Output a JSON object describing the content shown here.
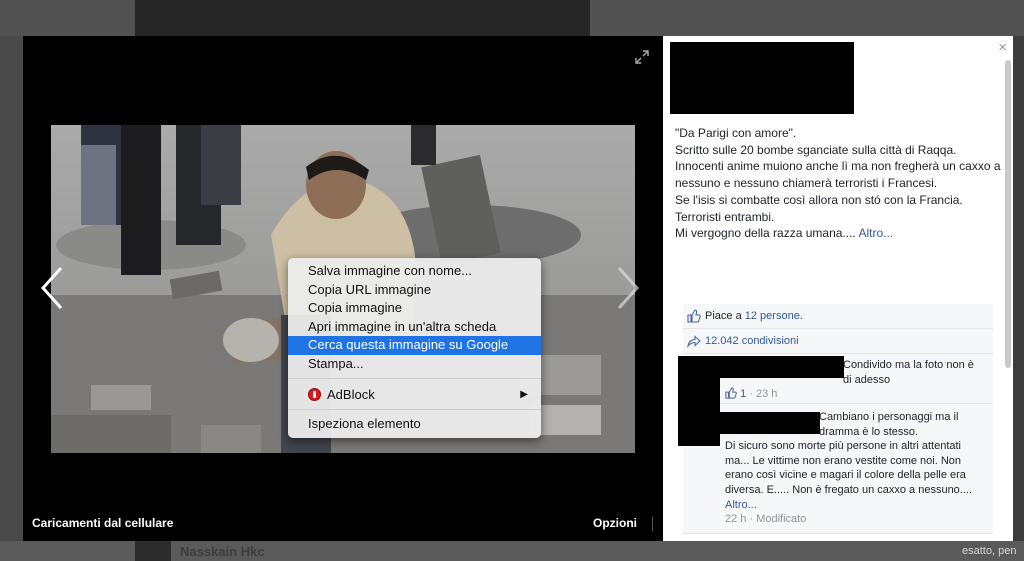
{
  "viewer": {
    "caption": "Caricamenti dal cellulare",
    "options_label": "Opzioni"
  },
  "context_menu": {
    "items": [
      "Salva immagine con nome...",
      "Copia URL immagine",
      "Copia immagine",
      "Apri immagine in un'altra scheda",
      "Cerca questa immagine su Google",
      "Stampa..."
    ],
    "highlighted_index": 4,
    "extension": "AdBlock",
    "inspect": "Ispeziona elemento"
  },
  "post": {
    "lines": [
      "\"Da Parigi con amore\".",
      "Scritto sulle 20 bombe sganciate sulla città di Raqqa.",
      "Innocenti anime muiono anche lì ma non fregherà un caxxo a nessuno e nessuno chiamerà terroristi i Francesi.",
      "Se l'isis si combatte così allora non stó con la Francia.",
      "Terroristi entrambi.",
      "Mi vergogno della razza umana...."
    ],
    "more_link": "Altro..."
  },
  "ufi": {
    "likes_prefix": "Piace a",
    "likes_link": "12 persone",
    "likes_suffix": ".",
    "shares": "12.042 condivisioni"
  },
  "comments": [
    {
      "text": "Condivido ma la foto non è di adesso",
      "likes": "1",
      "time": "23 h"
    },
    {
      "text": "Cambiano i personaggi ma il dramma è lo stesso.",
      "text2": "Di sicuro sono morte più persone in altri attentati ma... Le vittime non erano vestite come noi. Non erano così vicine e magari il colore della pelle era diversa. E..... Non è fregato un caxxo a nessuno....",
      "more_link": "Altro...",
      "time": "22 h",
      "edited": "Modificato"
    }
  ],
  "background": {
    "name": "Nasskain Hkc",
    "right_text": "esatto, pen"
  }
}
